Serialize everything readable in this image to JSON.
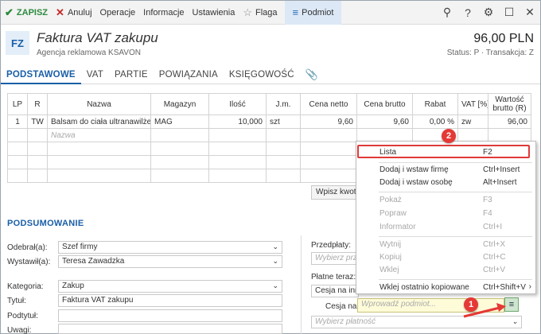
{
  "toolbar": {
    "save": "ZAPISZ",
    "cancel": "Anuluj",
    "operations": "Operacje",
    "info": "Informacje",
    "settings": "Ustawienia",
    "flag": "Flaga",
    "podmiot": "Podmiot"
  },
  "header": {
    "badge": "FZ",
    "title": "Faktura VAT zakupu",
    "subtitle": "Agencja reklamowa KSAVON",
    "amount": "96,00 PLN",
    "status": "Status: P  ·  Transakcja: Z"
  },
  "tabs": [
    "PODSTAWOWE",
    "VAT",
    "PARTIE",
    "POWIĄZANIA",
    "KSIĘGOWOŚĆ"
  ],
  "grid": {
    "columns": [
      "LP",
      "R",
      "Nazwa",
      "Magazyn",
      "Ilość",
      "J.m.",
      "Cena netto",
      "Cena brutto",
      "Rabat",
      "VAT [%]",
      "Wartość brutto (R)"
    ],
    "rows": [
      [
        "1",
        "TW",
        "Balsam do ciała ultranawilże...",
        "MAG",
        "10,000",
        "szt",
        "9,60",
        "9,60",
        "0,00 %",
        "zw",
        "96,00"
      ]
    ],
    "placeholder": "Nazwa",
    "wpisz": "Wpisz kwotę"
  },
  "summary": {
    "title": "PODSUMOWANIE",
    "odebral_label": "Odebrał(a):",
    "odebral": "Szef firmy",
    "wystawil_label": "Wystawił(a):",
    "wystawil": "Teresa Zawadzka",
    "kategoria_label": "Kategoria:",
    "kategoria": "Zakup",
    "tytul_label": "Tytuł:",
    "tytul": "Faktura VAT zakupu",
    "podtytul_label": "Podtytuł:",
    "uwagi_label": "Uwagi:",
    "przedplaty_label": "Przedpłaty:",
    "przedplaty_ph": "Wybierz przedpłatę...",
    "platne_label": "Płatne teraz:",
    "cesja_opt": "Cesja na innego podmiot",
    "cesja_label": "Cesja na:",
    "cesja_ph": "Wprowadź podmiot...",
    "platnosc_ph": "Wybierz płatność"
  },
  "menu": {
    "items": [
      {
        "label": "Lista",
        "key": "F2"
      },
      {
        "label": "Dodaj i wstaw firmę",
        "key": "Ctrl+Insert"
      },
      {
        "label": "Dodaj i wstaw osobę",
        "key": "Alt+Insert"
      },
      {
        "label": "Pokaż",
        "key": "F3"
      },
      {
        "label": "Popraw",
        "key": "F4"
      },
      {
        "label": "Informator",
        "key": "Ctrl+I"
      },
      {
        "label": "Wytnij",
        "key": "Ctrl+X"
      },
      {
        "label": "Kopiuj",
        "key": "Ctrl+C"
      },
      {
        "label": "Wklej",
        "key": "Ctrl+V"
      },
      {
        "label": "Wklej ostatnio kopiowane",
        "key": "Ctrl+Shift+V"
      }
    ]
  },
  "annotations": {
    "step1": "1",
    "step2": "2"
  },
  "colors": {
    "accent": "#1a5fa8",
    "save": "#2b8a3e",
    "annotation": "#e53935"
  }
}
